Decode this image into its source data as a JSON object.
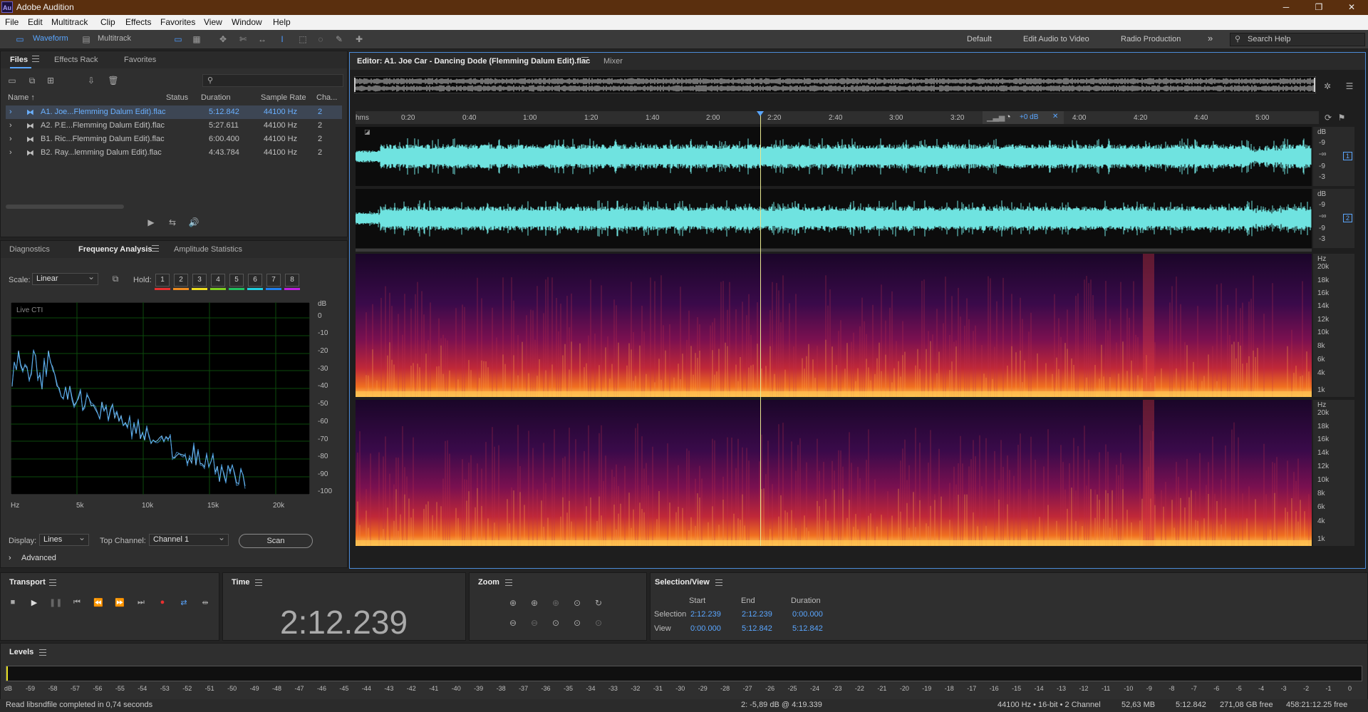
{
  "app": {
    "title": "Adobe Audition",
    "logo": "Au"
  },
  "window_controls": {
    "minimize": "─",
    "maximize": "❐",
    "close": "✕"
  },
  "menu": [
    "File",
    "Edit",
    "Multitrack",
    "Clip",
    "Effects",
    "Favorites",
    "View",
    "Window",
    "Help"
  ],
  "toolbar": {
    "waveform": "Waveform",
    "multitrack": "Multitrack",
    "workspaces": [
      "Default",
      "Edit Audio to Video",
      "Radio Production"
    ],
    "more": "»",
    "search_placeholder": "Search Help"
  },
  "files_panel": {
    "tabs": [
      "Files",
      "Effects Rack",
      "Favorites"
    ],
    "search_icon": "⚲",
    "columns": [
      "Name ↑",
      "Status",
      "Duration",
      "Sample Rate",
      "Cha..."
    ],
    "rows": [
      {
        "name": "A1. Joe...Flemming Dalum Edit).flac",
        "status": "",
        "duration": "5:12.842",
        "rate": "44100 Hz",
        "ch": "2"
      },
      {
        "name": "A2. P.E...Flemming Dalum Edit).flac",
        "status": "",
        "duration": "5:27.611",
        "rate": "44100 Hz",
        "ch": "2"
      },
      {
        "name": "B1. Ric...Flemming Dalum Edit).flac",
        "status": "",
        "duration": "6:00.400",
        "rate": "44100 Hz",
        "ch": "2"
      },
      {
        "name": "B2. Ray...lemming Dalum Edit).flac",
        "status": "",
        "duration": "4:43.784",
        "rate": "44100 Hz",
        "ch": "2"
      }
    ],
    "row_glyph": "›",
    "file_glyph": "⧓"
  },
  "analysis_panel": {
    "tabs": [
      "Diagnostics",
      "Frequency Analysis",
      "Amplitude Statistics"
    ],
    "scale_label": "Scale:",
    "scale_value": "Linear",
    "hold_label": "Hold:",
    "hold": [
      "1",
      "2",
      "3",
      "4",
      "5",
      "6",
      "7",
      "8"
    ],
    "hold_colors": [
      "#e83030",
      "#f08c20",
      "#f0e020",
      "#80d020",
      "#20c060",
      "#20d0e0",
      "#2080f0",
      "#c020e0"
    ],
    "graph_label": "Live CTI",
    "db_unit": "dB",
    "db_ticks": [
      "0",
      "-10",
      "-20",
      "-30",
      "-40",
      "-50",
      "-60",
      "-70",
      "-80",
      "-90",
      "-100"
    ],
    "hz_ticks": [
      "Hz",
      "5k",
      "10k",
      "15k",
      "20k"
    ],
    "display_label": "Display:",
    "display_value": "Lines",
    "top_channel_label": "Top Channel:",
    "top_channel_value": "Channel 1",
    "scan_label": "Scan",
    "advanced_label": "Advanced",
    "advanced_glyph": "›"
  },
  "editor": {
    "tab_title": "Editor: A1. Joe Car - Dancing Dode (Flemming Dalum Edit).flac",
    "mixer_tab": "Mixer",
    "ruler_unit": "hms",
    "ruler_ticks": [
      "0:20",
      "0:40",
      "1:00",
      "1:20",
      "1:40",
      "2:00",
      "2:20",
      "2:40",
      "3:00",
      "3:20",
      "4:00",
      "4:20",
      "4:40",
      "5:00"
    ],
    "volume_label": "+0 dB",
    "playhead_fraction": 0.423,
    "db_ticks_ch1": [
      "dB",
      "-9",
      "-∞",
      "-9",
      "-3"
    ],
    "db_ticks_ch2": [
      "dB",
      "-9",
      "-∞",
      "-9",
      "-3"
    ],
    "channel_ids": [
      "1",
      "2"
    ],
    "hz_ticks": [
      "Hz",
      "20k",
      "18k",
      "16k",
      "14k",
      "12k",
      "10k",
      "8k",
      "6k",
      "4k",
      "1k"
    ]
  },
  "transport": {
    "title": "Transport"
  },
  "time": {
    "title": "Time",
    "value": "2:12.239"
  },
  "zoom": {
    "title": "Zoom"
  },
  "selection_view": {
    "title": "Selection/View",
    "headers": [
      "Start",
      "End",
      "Duration"
    ],
    "selection_label": "Selection",
    "selection": [
      "2:12.239",
      "2:12.239",
      "0:00.000"
    ],
    "view_label": "View",
    "view": [
      "0:00.000",
      "5:12.842",
      "5:12.842"
    ]
  },
  "levels": {
    "title": "Levels",
    "db_label": "dB",
    "ticks": [
      "-59",
      "-58",
      "-57",
      "-56",
      "-55",
      "-54",
      "-53",
      "-52",
      "-51",
      "-50",
      "-49",
      "-48",
      "-47",
      "-46",
      "-45",
      "-44",
      "-43",
      "-42",
      "-41",
      "-40",
      "-39",
      "-38",
      "-37",
      "-36",
      "-35",
      "-34",
      "-33",
      "-32",
      "-31",
      "-30",
      "-29",
      "-28",
      "-27",
      "-26",
      "-25",
      "-24",
      "-23",
      "-22",
      "-21",
      "-20",
      "-19",
      "-18",
      "-17",
      "-16",
      "-15",
      "-14",
      "-13",
      "-12",
      "-11",
      "-10",
      "-9",
      "-8",
      "-7",
      "-6",
      "-5",
      "-4",
      "-3",
      "-2",
      "-1",
      "0"
    ]
  },
  "status": {
    "message": "Read libsndfile completed in 0,74 seconds",
    "cursor": "2: -5,89 dB @ 4:19.339",
    "format": "44100 Hz • 16-bit • 2 Channel",
    "size": "52,63 MB",
    "duration": "5:12.842",
    "free": "271,08 GB free",
    "free_time": "458:21:12.25 free"
  }
}
